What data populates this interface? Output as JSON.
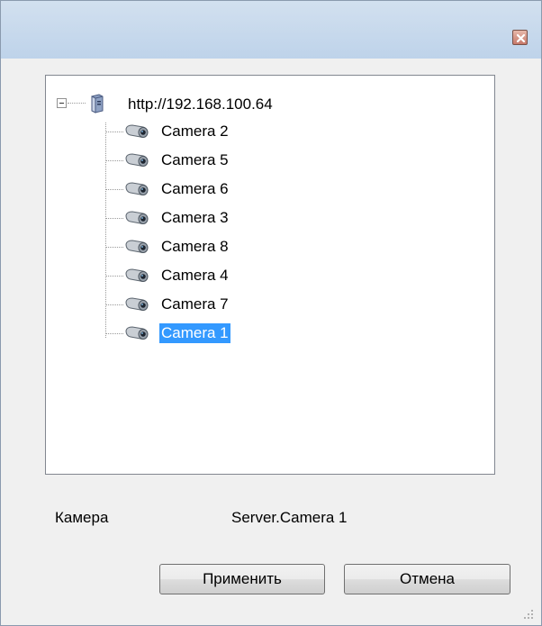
{
  "window": {
    "close_icon": "close-icon"
  },
  "tree": {
    "root": {
      "label": "http://192.168.100.64",
      "icon": "server-icon",
      "expanded": true
    },
    "items": [
      {
        "label": "Camera 2",
        "icon": "camera-icon",
        "selected": false
      },
      {
        "label": "Camera 5",
        "icon": "camera-icon",
        "selected": false
      },
      {
        "label": "Camera 6",
        "icon": "camera-icon",
        "selected": false
      },
      {
        "label": "Camera 3",
        "icon": "camera-icon",
        "selected": false
      },
      {
        "label": "Camera 8",
        "icon": "camera-icon",
        "selected": false
      },
      {
        "label": "Camera 4",
        "icon": "camera-icon",
        "selected": false
      },
      {
        "label": "Camera 7",
        "icon": "camera-icon",
        "selected": false
      },
      {
        "label": "Camera 1",
        "icon": "camera-icon",
        "selected": true
      }
    ]
  },
  "selection": {
    "label": "Камера",
    "value": "Server.Camera 1"
  },
  "buttons": {
    "apply": "Применить",
    "cancel": "Отмена"
  },
  "colors": {
    "selection_bg": "#3399ff",
    "selection_fg": "#ffffff",
    "title_bar": "#c8d9ec"
  }
}
